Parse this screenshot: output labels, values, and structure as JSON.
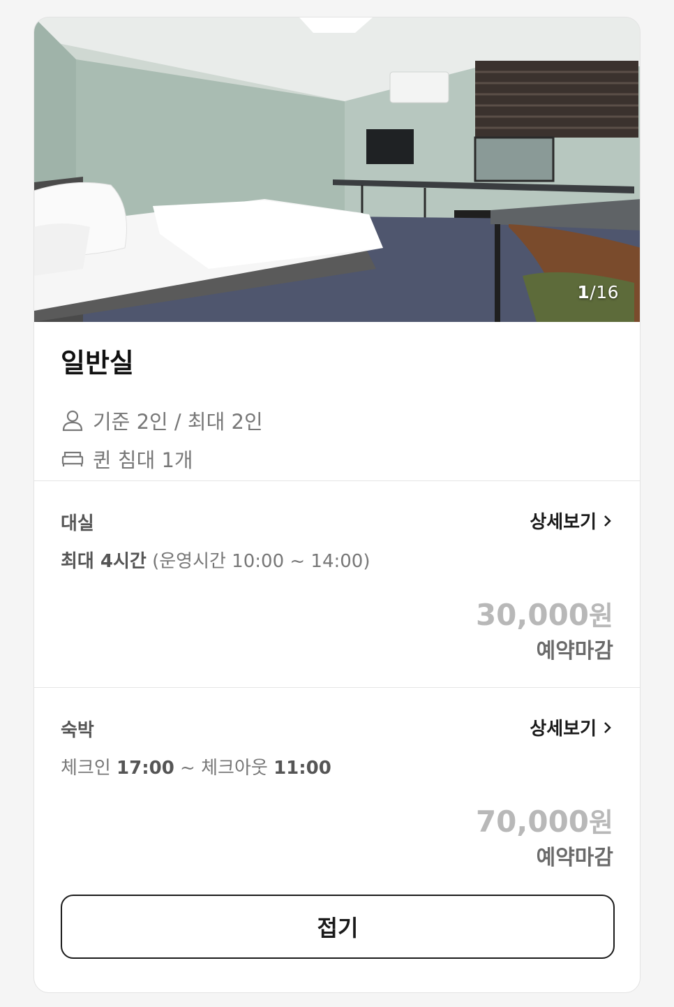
{
  "gallery": {
    "current": "1",
    "total": "/16"
  },
  "room": {
    "title": "일반실",
    "capacity": "기준 2인 / 최대 2인",
    "bed": "퀸 침대 1개",
    "icons": {
      "capacity": "person-icon",
      "bed": "bed-icon"
    }
  },
  "rates": [
    {
      "name": "대실",
      "detail_label": "상세보기",
      "desc_bold": "최대 4시간",
      "desc_rest": " (운영시간 10:00 ~ 14:00)",
      "price": "30,000",
      "currency": "원",
      "status": "예약마감"
    },
    {
      "name": "숙박",
      "detail_label": "상세보기",
      "checkin_label": "체크인 ",
      "checkin_time": "17:00",
      "separator": " ~ ",
      "checkout_label": "체크아웃 ",
      "checkout_time": "11:00",
      "price": "70,000",
      "currency": "원",
      "status": "예약마감"
    }
  ],
  "fold_button": "접기",
  "colors": {
    "price_soldout": "#b8b8b8",
    "text_muted": "#777777",
    "border": "#e5e5e5"
  }
}
